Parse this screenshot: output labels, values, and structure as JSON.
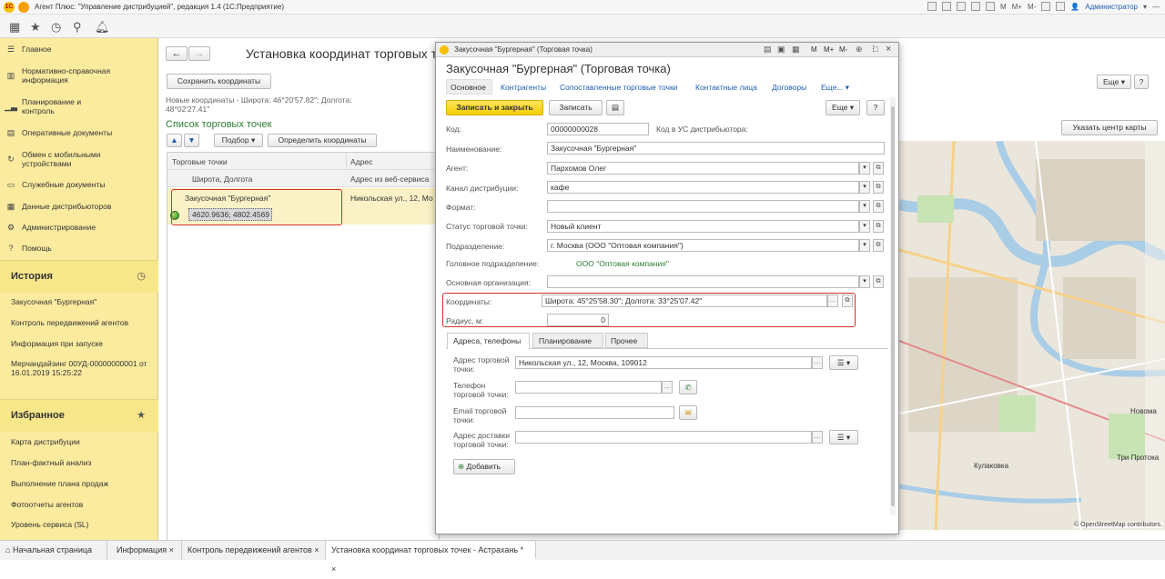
{
  "app": {
    "title": "Агент Плюс: \"Управление дистрибуцией\", редакция 1.4   (1С:Предприятие)",
    "user": "Администратор",
    "title_icons": [
      "M",
      "M+",
      "M-"
    ]
  },
  "sidebar": {
    "items": [
      {
        "icon": "menu-icon",
        "label": "Главное"
      },
      {
        "icon": "books-icon",
        "label": "Нормативно-справочная информация"
      },
      {
        "icon": "chart-icon",
        "label": "Планирование и контроль"
      },
      {
        "icon": "docs-icon",
        "label": "Оперативные документы"
      },
      {
        "icon": "sync-icon",
        "label": "Обмен с мобильными устройствами"
      },
      {
        "icon": "doc-icon",
        "label": "Служебные документы"
      },
      {
        "icon": "table-icon",
        "label": "Данные дистрибьюторов"
      },
      {
        "icon": "gear-icon",
        "label": "Администрирование"
      },
      {
        "icon": "help-icon",
        "label": "Помощь"
      }
    ],
    "history": {
      "title": "История",
      "items": [
        "Закусочная \"Бургерная\"",
        "Контроль передвижений агентов",
        "Информация при запуске",
        "Мерчандайзинг 00УД-00000000001 от 16.01.2019 15:25:22"
      ]
    },
    "favorites": {
      "title": "Избранное",
      "items": [
        "Карта дистрибуции",
        "План-фактный анализ",
        "Выполнение плана продаж",
        "Фотоотчеты агентов",
        "Уровень сервиса (SL)"
      ]
    }
  },
  "page": {
    "title": "Установка координат торговых точе",
    "save_coords": "Сохранить координаты",
    "new_coords": "Новые координаты - Широта: 46°20'57.82\"; Долгота: 48°02'27.41\"",
    "list_title": "Список торговых точек",
    "select_btn": "Подбор",
    "determine_btn": "Определить координаты",
    "col_points": "Торговые точки",
    "col_address": "Адрес",
    "sub_col_coords": "Широта, Долгота",
    "sub_col_webaddr": "Адрес из веб-сервиса",
    "row_name": "Закусочная \"Бургерная\"",
    "row_address": "Никольская ул., 12, Мо",
    "row_coords": "4620.9636;  4802.4569",
    "more_btn": "Еще",
    "map_center_btn": "Указать центр карты",
    "map_labels": [
      "Кулаковка",
      "Новома",
      "Три Протока"
    ],
    "map_attribution": "© OpenStreetMap contributors."
  },
  "modal": {
    "window_title": "Закусочная \"Бургерная\" (Торговая точка)",
    "heading": "Закусочная \"Бургерная\" (Торговая точка)",
    "window_icons": [
      "M",
      "M+",
      "M-"
    ],
    "tabs": [
      "Основное",
      "Контрагенты",
      "Сопоставленные торговые точки",
      "Контактные лица",
      "Договоры",
      "Еще..."
    ],
    "save_close": "Записать и закрыть",
    "save": "Записать",
    "more": "Еще",
    "help": "?",
    "fields": {
      "code_label": "Код:",
      "code_value": "00000000028",
      "code_us_label": "Код в УС дистрибьютора:",
      "name_label": "Наименование:",
      "name_value": "Закусочная \"Бургерная\"",
      "agent_label": "Агент:",
      "agent_value": "Пархомов Олег",
      "channel_label": "Канал дистрибуции:",
      "channel_value": "кафе",
      "format_label": "Формат:",
      "format_value": "",
      "status_label": "Статус торговой точки:",
      "status_value": "Новый клиент",
      "division_label": "Подразделение:",
      "division_value": "г. Москва  (ООО \"Оптовая компания\")",
      "head_division_label": "Головное подразделение:",
      "head_division_value": "ООО \"Оптовая компания\"",
      "org_label": "Основная организация:",
      "org_value": "",
      "coords_label": "Координаты:",
      "coords_value": "Широта: 45°25'58.30\"; Долгота: 33°25'07.42\"",
      "radius_label": "Радиус, м:",
      "radius_value": "0"
    },
    "subtabs": [
      "Адреса, телефоны",
      "Планирование",
      "Прочее"
    ],
    "contacts": {
      "addr_label": "Адрес торговой точки:",
      "addr_value": "Никольская ул., 12, Москва, 109012",
      "phone_label": "Телефон торговой точки:",
      "phone_value": "",
      "email_label": "Email торговой точки:",
      "email_value": "",
      "delivery_label": "Адрес доставки торговой точки:",
      "delivery_value": "",
      "add_btn": "Добавить"
    }
  },
  "bottom_tabs": [
    "Начальная страница",
    "Информация",
    "Контроль передвижений агентов",
    "Установка координат торговых точек - Астрахань *"
  ]
}
